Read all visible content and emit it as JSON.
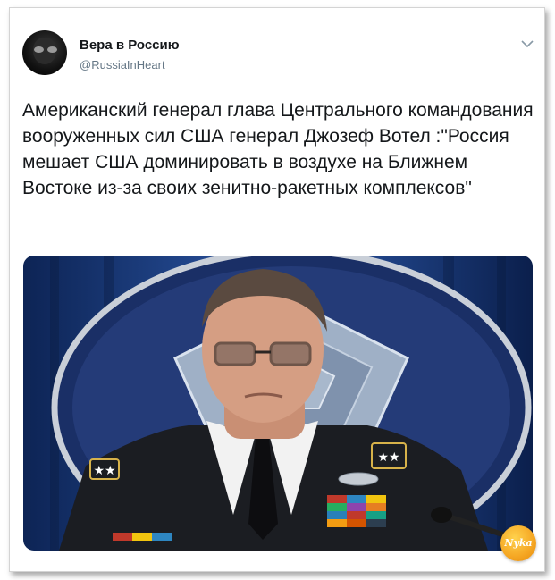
{
  "tweet": {
    "author_name": "Вера в Россию",
    "author_handle": "@RussiaInHeart",
    "avatar_icon": "profile-avatar-icon",
    "menu_icon": "chevron-down-icon",
    "text": "Американский генерал глава Центрального командования вооруженных сил США генерал Джозеф Вотел :\"Россия мешает США доминировать в воздухе на Ближнем Востоке из-за своих зенитно-ракетных комплексов\""
  },
  "watermark": {
    "text": "Nyka",
    "color": "#f5a623"
  },
  "colors": {
    "name": "#14171a",
    "handle": "#657786",
    "chevron": "#8899a6"
  }
}
